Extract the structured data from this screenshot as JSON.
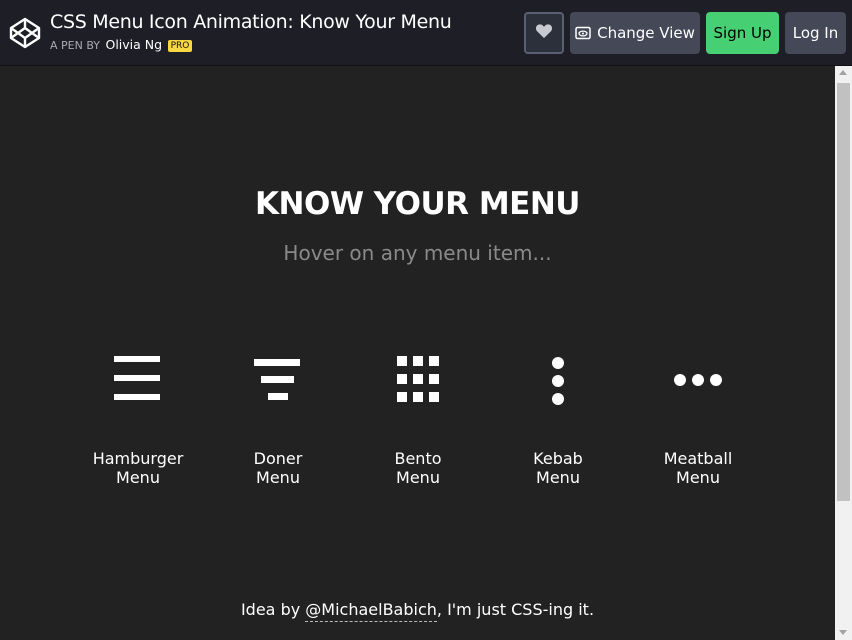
{
  "header": {
    "title": "CSS Menu Icon Animation: Know Your Menu",
    "byline_prefix": "A PEN BY",
    "author": "Olivia Ng",
    "badge": "PRO",
    "buttons": {
      "heart_icon": "heart-icon",
      "change_view": "Change View",
      "sign_up": "Sign Up",
      "log_in": "Log In"
    },
    "colors": {
      "sign_up": "#47cf73",
      "badge": "#f7d843"
    }
  },
  "main": {
    "heading": "KNOW YOUR MENU",
    "subheading": "Hover on any menu item...",
    "menus": [
      {
        "icon": "hamburger-icon",
        "line1": "Hamburger",
        "line2": "Menu"
      },
      {
        "icon": "doner-icon",
        "line1": "Doner",
        "line2": "Menu"
      },
      {
        "icon": "bento-icon",
        "line1": "Bento",
        "line2": "Menu"
      },
      {
        "icon": "kebab-icon",
        "line1": "Kebab",
        "line2": "Menu"
      },
      {
        "icon": "meatball-icon",
        "line1": "Meatball",
        "line2": "Menu"
      }
    ],
    "footer": {
      "prefix": "Idea by",
      "link": "@MichaelBabich",
      "suffix": ", I'm just CSS-ing it."
    }
  }
}
